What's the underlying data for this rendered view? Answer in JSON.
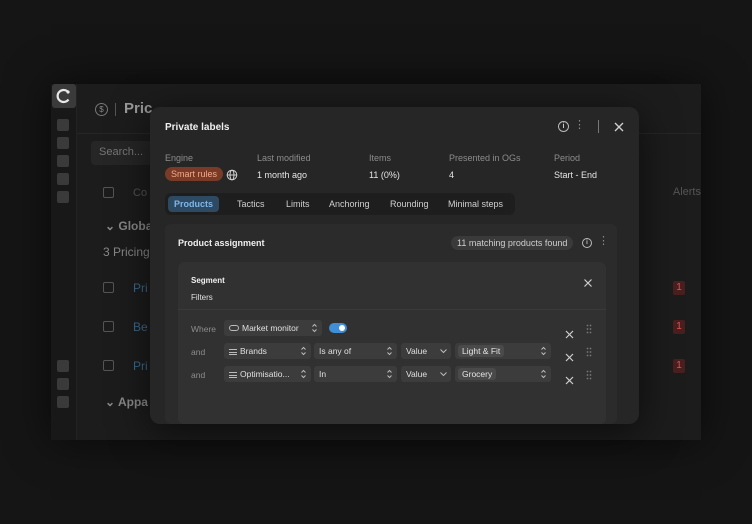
{
  "background_app": {
    "header_title": "Pric",
    "search_placeholder": "Search...",
    "column_c": "Co",
    "column_alerts": "Alerts",
    "group_global": "Globa",
    "pricing_count": "3 Pricing",
    "rows": [
      {
        "name": "Pri",
        "alert": "1"
      },
      {
        "name": "Be",
        "alert": "1"
      },
      {
        "name": "Pri",
        "alert": "1"
      }
    ],
    "group_apparel": "Appa"
  },
  "modal": {
    "title": "Private labels",
    "meta": {
      "engine_label": "Engine",
      "engine_value": "Smart rules",
      "last_modified_label": "Last modified",
      "last_modified_value": "1 month ago",
      "items_label": "Items",
      "items_value": "11 (0%)",
      "presented_label": "Presented in OGs",
      "presented_value": "4",
      "period_label": "Period",
      "period_value": "Start - End"
    },
    "tabs": [
      "Products",
      "Tactics",
      "Limits",
      "Anchoring",
      "Rounding",
      "Minimal steps"
    ],
    "active_tab": "Products",
    "product_assignment": {
      "title": "Product assignment",
      "matching": "11 matching products found",
      "segment": {
        "title": "Segment",
        "filters_label": "Filters",
        "rows": [
          {
            "prefix": "Where",
            "field": "Market monitor",
            "toggle_on": true
          },
          {
            "prefix": "and",
            "field": "Brands",
            "operator": "Is any of",
            "mode": "Value",
            "value": "Light & Fit"
          },
          {
            "prefix": "and",
            "field": "Optimisatio...",
            "operator": "In",
            "mode": "Value",
            "value": "Grocery"
          }
        ]
      }
    }
  },
  "colors": {
    "accent": "#3e8ed8",
    "engine_pill_bg": "#7a3b26",
    "engine_pill_text": "#f1a88c",
    "active_tab_bg": "#2e4a63",
    "active_tab_text": "#7fb6e8"
  }
}
